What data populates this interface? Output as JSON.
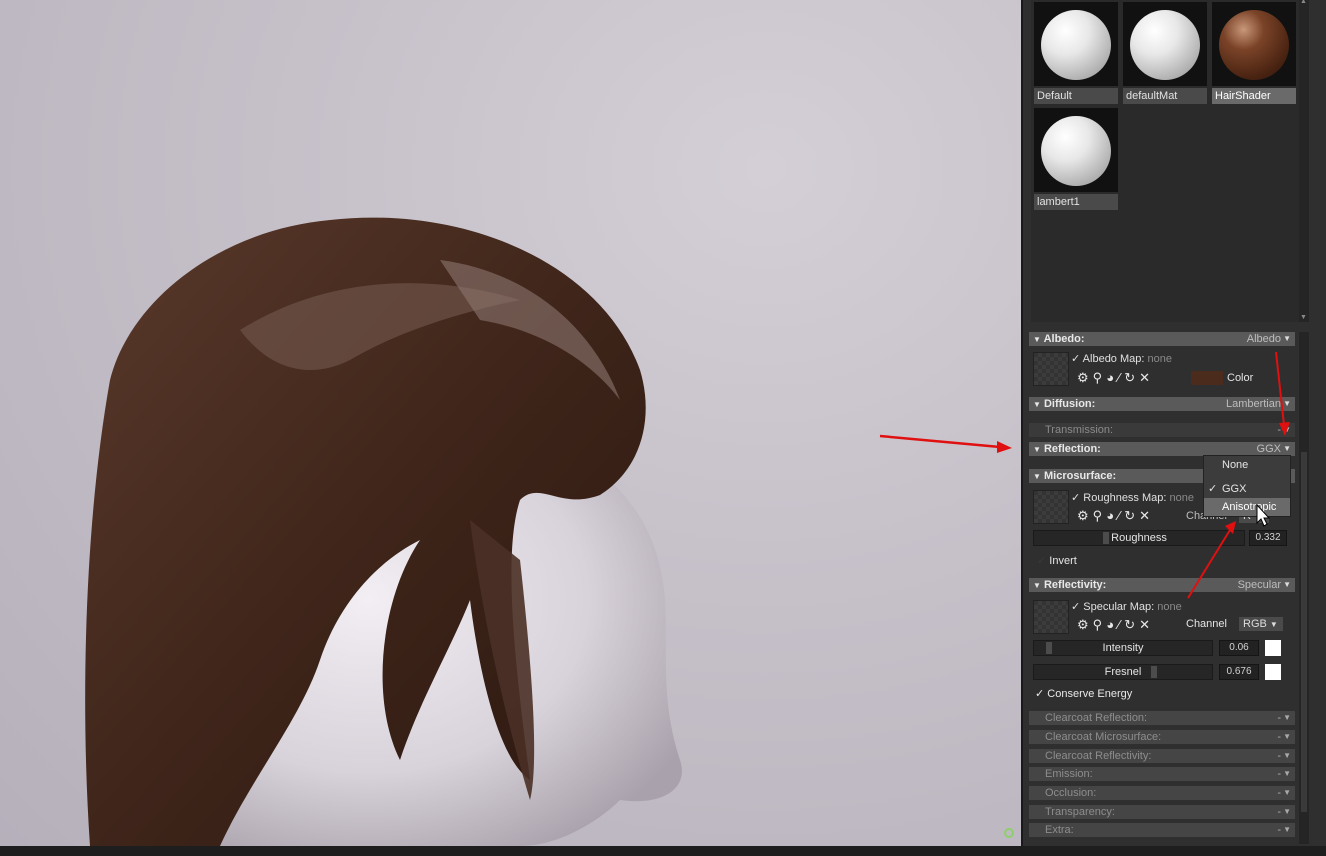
{
  "materials": [
    {
      "name": "Default",
      "selected": false,
      "color": "#e6e6e6"
    },
    {
      "name": "defaultMat",
      "selected": false,
      "color": "#e6e6e6"
    },
    {
      "name": "HairShader",
      "selected": true,
      "color": "#6b3a22"
    },
    {
      "name": "lambert1",
      "selected": false,
      "color": "#e6e6e6"
    }
  ],
  "albedo": {
    "header": "Albedo:",
    "mode": "Albedo",
    "map_label": "Albedo Map:",
    "map_value": "none",
    "color_label": "Color",
    "color": "#4a2b1c"
  },
  "diffusion": {
    "header": "Diffusion:",
    "mode": "Lambertian"
  },
  "transmission": {
    "label": "Transmission:",
    "value": "-"
  },
  "reflection": {
    "header": "Reflection:",
    "mode": "GGX"
  },
  "reflection_menu": {
    "options": [
      "None",
      "GGX",
      "Anisotropic"
    ],
    "checked": "GGX",
    "highlighted": "Anisotropic"
  },
  "microsurface": {
    "header": "Microsurface:",
    "map_label": "Roughness Map:",
    "map_value": "none",
    "channel_label": "Channel",
    "channel_value": "R",
    "slider_label": "Roughness",
    "slider_value": "0.332",
    "slider_level": 0.332,
    "invert_label": "Invert"
  },
  "reflectivity": {
    "header": "Reflectivity:",
    "mode": "Specular",
    "map_label": "Specular Map:",
    "map_value": "none",
    "channel_label": "Channel",
    "channel_value": "RGB",
    "intensity_label": "Intensity",
    "intensity_value": "0.06",
    "intensity_level": 0.06,
    "fresnel_label": "Fresnel",
    "fresnel_value": "0.676",
    "fresnel_level": 0.676,
    "conserve_label": "Conserve Energy"
  },
  "collapsed_sections": [
    {
      "label": "Clearcoat Reflection:",
      "value": "-"
    },
    {
      "label": "Clearcoat Microsurface:",
      "value": "-"
    },
    {
      "label": "Clearcoat Reflectivity:",
      "value": "-"
    },
    {
      "label": "Emission:",
      "value": "-"
    },
    {
      "label": "Occlusion:",
      "value": "-"
    },
    {
      "label": "Transparency:",
      "value": "-"
    },
    {
      "label": "Extra:",
      "value": "-"
    }
  ],
  "icons": {
    "tool_row": [
      "gear-icon",
      "magnify-icon",
      "picker-icon",
      "brush-icon",
      "refresh-icon",
      "close-icon"
    ],
    "cursor": "arrow-cursor-icon",
    "annotations": "red-arrow-icon"
  },
  "accent_colors": {
    "annotation_red": "#e01010",
    "status_green": "#8fcf6b",
    "highlight": "#6a6a6a"
  }
}
